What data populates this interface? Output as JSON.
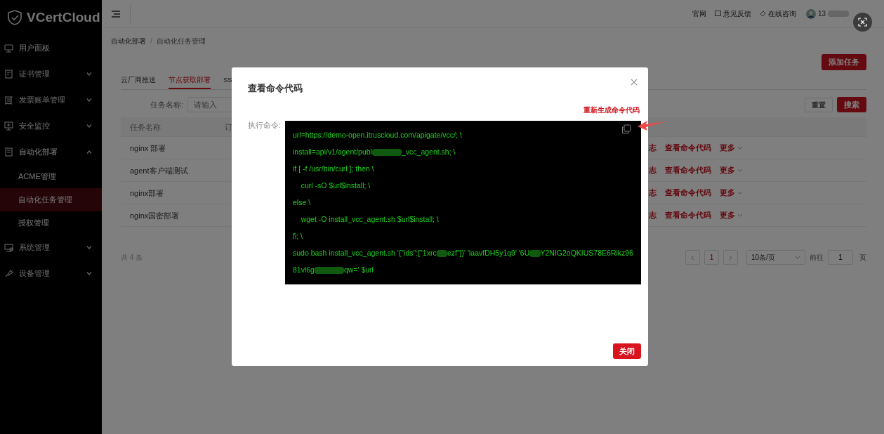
{
  "sidebar": {
    "logo": "VCertCloud",
    "items": [
      {
        "label": "用户面板",
        "kind": "link"
      },
      {
        "label": "证书管理",
        "kind": "group",
        "expanded": false
      },
      {
        "label": "发票账单管理",
        "kind": "group",
        "expanded": false
      },
      {
        "label": "安全监控",
        "kind": "group",
        "expanded": false
      },
      {
        "label": "自动化部署",
        "kind": "group",
        "expanded": true,
        "children": [
          {
            "label": "ACME管理",
            "selected": false
          },
          {
            "label": "自动化任务管理",
            "selected": true
          },
          {
            "label": "授权管理",
            "selected": false
          }
        ]
      },
      {
        "label": "系统管理",
        "kind": "group",
        "expanded": false
      },
      {
        "label": "设备管理",
        "kind": "group",
        "expanded": false
      }
    ]
  },
  "header": {
    "links": [
      {
        "label": "官网"
      },
      {
        "label": "意见反馈"
      },
      {
        "label": "在线咨询"
      }
    ],
    "user": "13"
  },
  "breadcrumb": [
    "自动化部署",
    "自动化任务管理"
  ],
  "breadcrumb_separator": "/",
  "add_button": "添加任务",
  "tabs": [
    {
      "label": "云厂商推送",
      "selected": false
    },
    {
      "label": "节点获取部署",
      "selected": true
    },
    {
      "label": "SS",
      "selected": false
    }
  ],
  "filter": {
    "label": "任务名称:",
    "placeholder": "请输入",
    "reset": "重置",
    "search": "搜索"
  },
  "table": {
    "columns": [
      "任务名称",
      "订"
    ],
    "rows": [
      {
        "name": "nginx 部署",
        "actions": [
          "志",
          "查看命令代码",
          "更多"
        ]
      },
      {
        "name": "agent客户端测试",
        "actions": [
          "志",
          "查看命令代码",
          "更多"
        ]
      },
      {
        "name": "nginx部署",
        "actions": [
          "志",
          "查看命令代码",
          "更多"
        ]
      },
      {
        "name": "nginx国密部署",
        "actions": [
          "志",
          "查看命令代码",
          "更多"
        ]
      }
    ]
  },
  "total": "共 4 条",
  "pagination": {
    "pages": [
      {
        "label": "1",
        "selected": true
      }
    ],
    "page_size": "10条/页",
    "goto_label": "前往",
    "goto_value": "1",
    "unit": "页"
  },
  "modal": {
    "title": "查看命令代码",
    "regenerate": "重新生成命令代码",
    "field_label": "执行命令:",
    "close_button": "关闭",
    "code_lines": [
      {
        "parts": [
          {
            "kind": "text",
            "text": "url=https://demo-open.itruscloud.com/apigate/vcc/; \\"
          }
        ]
      },
      {
        "parts": [
          {
            "kind": "text",
            "text": "install=api/v1/agent/publ"
          },
          {
            "kind": "redacted"
          },
          {
            "kind": "text",
            "text": "_vcc_agent.sh; \\"
          }
        ]
      },
      {
        "parts": [
          {
            "kind": "text",
            "text": "if [ -f /usr/bin/curl ]; then \\"
          }
        ]
      },
      {
        "parts": [
          {
            "kind": "text",
            "text": "    curl -sO $url$install; \\"
          }
        ]
      },
      {
        "parts": [
          {
            "kind": "text",
            "text": "else \\"
          }
        ]
      },
      {
        "parts": [
          {
            "kind": "text",
            "text": "    wget -O install_vcc_agent.sh $url$install; \\"
          }
        ]
      },
      {
        "parts": [
          {
            "kind": "text",
            "text": "fi; \\"
          }
        ]
      },
      {
        "parts": [
          {
            "kind": "text",
            "text": "sudo bash install_vcc_agent.sh '{\"ids\":[\"1xrc"
          },
          {
            "kind": "redacted"
          },
          {
            "kind": "text",
            "text": "ezf\"]}' 'laavfDH5y1q9' '6U"
          },
          {
            "kind": "redacted"
          },
          {
            "kind": "text",
            "text": "Y2NIG2oQKIUS78E6Rikz96"
          }
        ]
      },
      {
        "parts": [
          {
            "kind": "text",
            "text": "81vl6g"
          },
          {
            "kind": "redacted"
          },
          {
            "kind": "text",
            "text": "qw=' $url"
          }
        ]
      }
    ]
  }
}
